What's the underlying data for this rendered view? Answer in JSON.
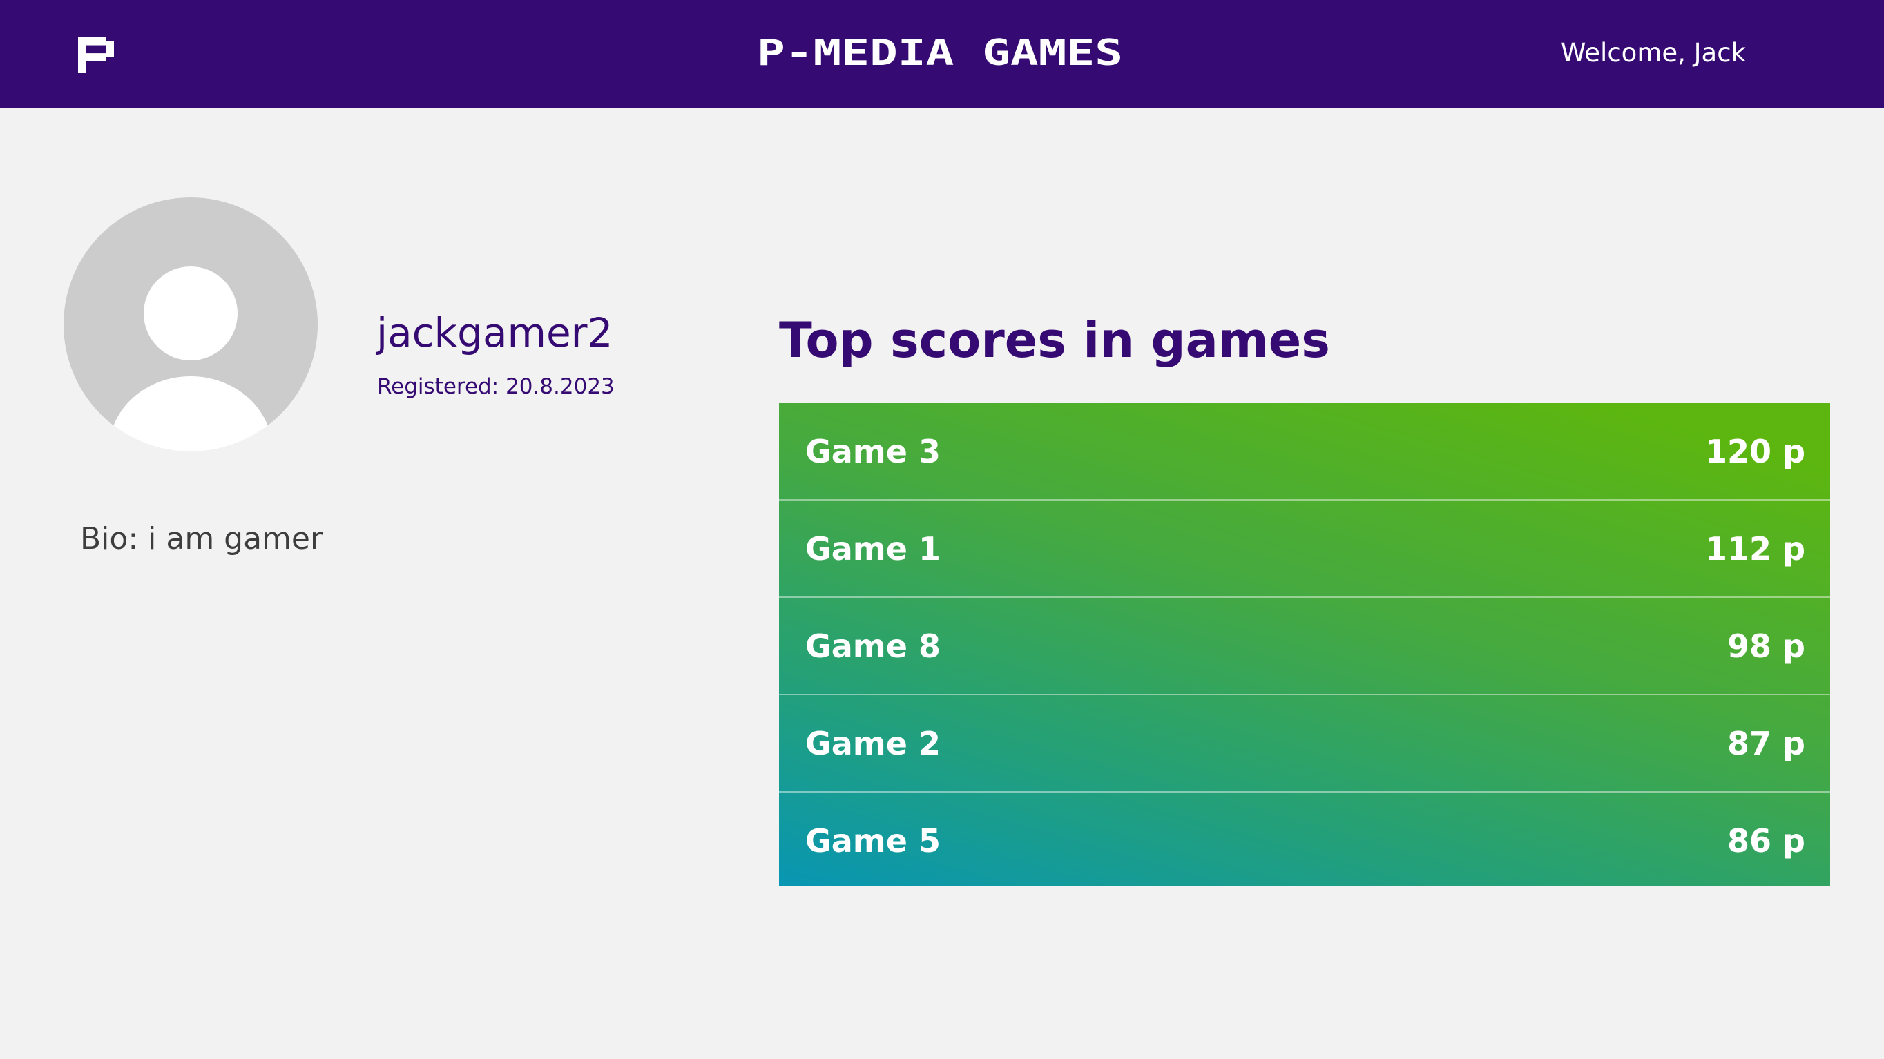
{
  "header": {
    "logo_icon": "pixel-p-logo-icon",
    "title": "P-MEDIA GAMES",
    "welcome": "Welcome, Jack",
    "background_color": "#360a73"
  },
  "profile": {
    "avatar_icon": "default-user-avatar-icon",
    "username": "jackgamer2",
    "registered": "Registered: 20.8.2023",
    "bio": "Bio: i am gamer"
  },
  "top_scores": {
    "title": "Top scores in games",
    "rows": [
      {
        "game": "Game 3",
        "score": "120 p"
      },
      {
        "game": "Game 1",
        "score": "112 p"
      },
      {
        "game": "Game 8",
        "score": "98 p"
      },
      {
        "game": "Game 2",
        "score": "87 p"
      },
      {
        "game": "Game 5",
        "score": "86 p"
      }
    ],
    "gradient_colors": [
      "#5db60f",
      "#0896b3"
    ]
  }
}
